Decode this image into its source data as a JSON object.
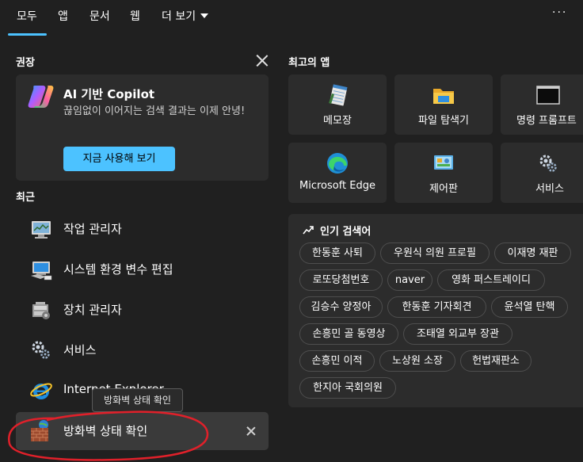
{
  "tabs": [
    {
      "label": "모두"
    },
    {
      "label": "앱"
    },
    {
      "label": "문서"
    },
    {
      "label": "웹"
    },
    {
      "label": "더 보기"
    }
  ],
  "recommended": {
    "title": "권장",
    "card_title": "AI 기반 Copilot",
    "card_desc": "끊임없이 이어지는 검색 결과는 이제 안녕!",
    "card_button": "지금 사용해 보기"
  },
  "recent": {
    "title": "최근",
    "items": [
      {
        "label": "작업 관리자",
        "icon": "task-manager-icon"
      },
      {
        "label": "시스템 환경 변수 편집",
        "icon": "system-properties-icon"
      },
      {
        "label": "장치 관리자",
        "icon": "device-manager-icon"
      },
      {
        "label": "서비스",
        "icon": "services-gear-icon"
      },
      {
        "label": "Internet Explorer",
        "icon": "internet-explorer-icon"
      },
      {
        "label": "방화벽 상태 확인",
        "icon": "firewall-icon"
      }
    ],
    "tooltip": "방화벽 상태 확인"
  },
  "top_apps": {
    "title": "최고의 앱",
    "items": [
      {
        "label": "메모장",
        "icon": "notepad-icon"
      },
      {
        "label": "파일 탐색기",
        "icon": "folder-icon"
      },
      {
        "label": "명령 프롬프트",
        "icon": "command-prompt-icon"
      },
      {
        "label": "Microsoft Edge",
        "icon": "edge-icon"
      },
      {
        "label": "제어판",
        "icon": "control-panel-icon"
      },
      {
        "label": "서비스",
        "icon": "services-gear-icon"
      }
    ]
  },
  "trending": {
    "title": "인기 검색어",
    "chips": [
      "한동훈 사퇴",
      "우원식 의원 프로필",
      "이재명 재판",
      "로또당첨번호",
      "naver",
      "영화 퍼스트레이디",
      "김승수 양정아",
      "한동훈 기자회견",
      "윤석열 탄핵",
      "손흥민 골 동영상",
      "조태열 외교부 장관",
      "손흥민 이적",
      "노상원 소장",
      "헌법재판소",
      "한지아 국회의원"
    ]
  },
  "colors": {
    "background": "#202020",
    "card": "#2c2c2c",
    "accent": "#4cc2ff",
    "annotation": "#e0202a"
  }
}
